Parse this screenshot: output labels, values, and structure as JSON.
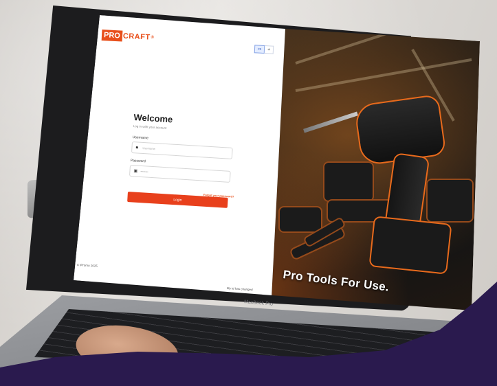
{
  "logo": {
    "part1": "PRO",
    "part2": "CRAFT",
    "mark": "®"
  },
  "language": {
    "active": "cs",
    "other": "≑"
  },
  "login": {
    "title": "Welcome",
    "subtitle": "Log in with your account",
    "username_label": "Username",
    "username_placeholder": "Username",
    "password_label": "Password",
    "password_placeholder": "••••••••",
    "forgot_link": "Forgot your password?",
    "submit_label": "Login"
  },
  "footer": {
    "copyright": "© iPromo 2025",
    "changed_note": "My id has changed"
  },
  "hero": {
    "tagline": "Pro Tools For Use."
  },
  "device": {
    "keyboard_label": "MacBook Pro"
  },
  "colors": {
    "brand": "#e8501c",
    "button": "#e8401c",
    "swoosh": "#2a1a4e"
  }
}
